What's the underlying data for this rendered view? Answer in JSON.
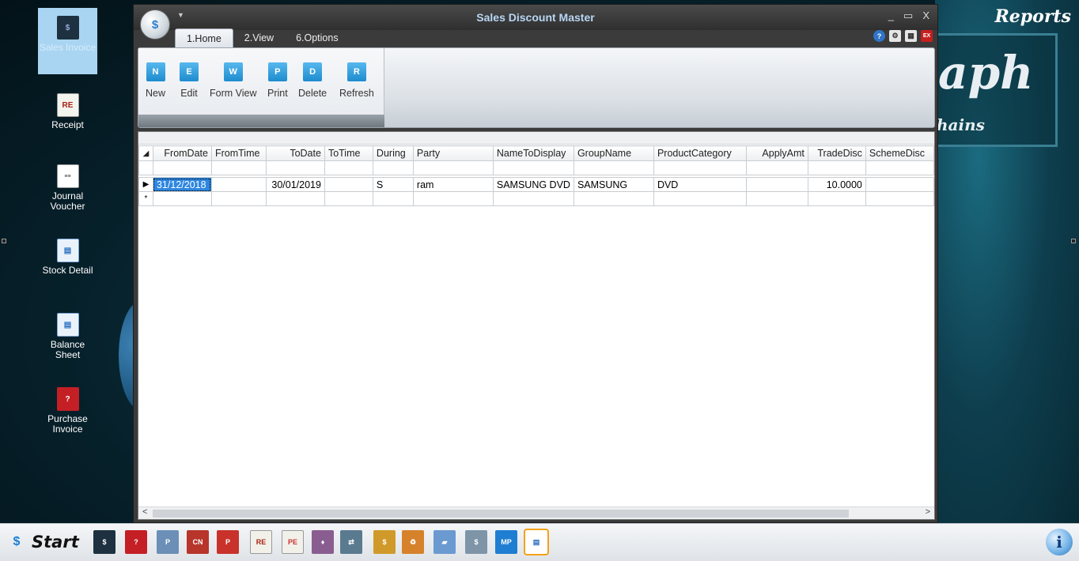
{
  "window": {
    "title": "Sales Discount Master",
    "controls": {
      "minimize": "_",
      "restore": "▭",
      "close": "X"
    }
  },
  "tabs": [
    {
      "label": "1.Home",
      "active": true
    },
    {
      "label": "2.View",
      "active": false
    },
    {
      "label": "6.Options",
      "active": false
    }
  ],
  "ribbon": {
    "buttons": [
      {
        "label": "New",
        "icon": "new-icon",
        "glyph": "N"
      },
      {
        "label": "Edit",
        "icon": "edit-icon",
        "glyph": "E"
      },
      {
        "label": "Form View",
        "icon": "form-view-icon",
        "glyph": "W"
      },
      {
        "label": "Print",
        "icon": "print-icon",
        "glyph": "P"
      },
      {
        "label": "Delete",
        "icon": "delete-icon",
        "glyph": "D"
      },
      {
        "label": "Refresh",
        "icon": "refresh-icon",
        "glyph": "R"
      }
    ]
  },
  "grid": {
    "columns": [
      "FromDate",
      "FromTime",
      "ToDate",
      "ToTime",
      "During",
      "Party",
      "NameToDisplay",
      "GroupName",
      "ProductCategory",
      "ApplyAmt",
      "TradeDisc",
      "SchemeDisc"
    ],
    "rows": [
      [
        "31/12/2018",
        "",
        "30/01/2019",
        "",
        "S",
        "ram",
        "SAMSUNG DVD",
        "SAMSUNG",
        "DVD",
        "",
        "10.0000",
        ""
      ]
    ],
    "new_row_marker": "*",
    "current_row_marker": "▶",
    "scroll_left": "<",
    "scroll_right": ">"
  },
  "desktop": {
    "icons": [
      {
        "label": "Sales Invoice",
        "icon": "sales-invoice-icon",
        "selected": true
      },
      {
        "label": "Receipt",
        "icon": "receipt-icon"
      },
      {
        "label": "Journal Voucher",
        "icon": "journal-voucher-icon"
      },
      {
        "label": "Stock Detail",
        "icon": "stock-detail-icon"
      },
      {
        "label": "Balance Sheet",
        "icon": "balance-sheet-icon"
      },
      {
        "label": "Purchase Invoice",
        "icon": "purchase-invoice-icon"
      }
    ],
    "reports_label": "Reports",
    "logo_text_large": "aph",
    "logo_text_small": "hains"
  },
  "taskbar": {
    "start_label": "Start",
    "info_label": "i"
  },
  "colors": {
    "accent": "#2e87e0",
    "title_text": "#b8d6f4",
    "ribbon_icon": "#1d8ccf"
  }
}
